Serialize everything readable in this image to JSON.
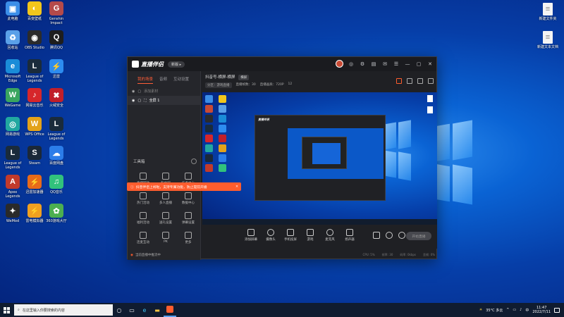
{
  "desktop": {
    "left_icons": [
      {
        "label": "此电脑",
        "glyph": "▣",
        "color": "#3b8ee8"
      },
      {
        "label": "百变壁纸",
        "glyph": "◐",
        "color": "#f2c61b"
      },
      {
        "label": "Genshin Impact",
        "glyph": "G",
        "color": "#b44a4a"
      },
      {
        "label": "回收站",
        "glyph": "♻",
        "color": "#5aa0e8"
      },
      {
        "label": "OBS Studio",
        "glyph": "◉",
        "color": "#2b2b2b"
      },
      {
        "label": "腾讯QQ",
        "glyph": "Q",
        "color": "#1e1e1e"
      },
      {
        "label": "Microsoft Edge",
        "glyph": "e",
        "color": "#1a8cd8"
      },
      {
        "label": "League of Legends",
        "glyph": "L",
        "color": "#1a2b3b"
      },
      {
        "label": "迅雷",
        "glyph": "⚡",
        "color": "#2d8cf0"
      },
      {
        "label": "WeGame",
        "glyph": "W",
        "color": "#3aa55f"
      },
      {
        "label": "网易云音乐",
        "glyph": "♪",
        "color": "#d6262b"
      },
      {
        "label": "火绒安全",
        "glyph": "✖",
        "color": "#c01f2a"
      },
      {
        "label": "网易游戏",
        "glyph": "◎",
        "color": "#21a8a0"
      },
      {
        "label": "WPS Office",
        "glyph": "W",
        "color": "#e3a21a"
      },
      {
        "label": "League of Legends",
        "glyph": "L",
        "color": "#1a2b3b"
      },
      {
        "label": "League of Legends",
        "glyph": "L",
        "color": "#1a2b3b"
      },
      {
        "label": "Steam",
        "glyph": "S",
        "color": "#1b2838"
      },
      {
        "label": "百度网盘",
        "glyph": "☁",
        "color": "#2b7de9"
      },
      {
        "label": "Apex Legends",
        "glyph": "A",
        "color": "#c23a2b"
      },
      {
        "label": "迅雷加速器",
        "glyph": "⚡",
        "color": "#e86a1a"
      },
      {
        "label": "QQ音乐",
        "glyph": "♫",
        "color": "#31c27c"
      },
      {
        "label": "WeMod",
        "glyph": "✦",
        "color": "#2a2a2a"
      },
      {
        "label": "雷电模拟器",
        "glyph": "⚡",
        "color": "#f0a020"
      },
      {
        "label": "360游戏大厅",
        "glyph": "✿",
        "color": "#4caf50"
      }
    ],
    "right_icons": [
      {
        "label": "新建文件夹"
      },
      {
        "label": "新建文本文档"
      }
    ]
  },
  "app": {
    "title": "直播伴侣",
    "version_badge": "新版 ▸",
    "left_tabs": [
      "我的场景",
      "音频",
      "互动设置"
    ],
    "scene_add_label": "添加素材",
    "scene_name": "全屏 1",
    "toolbox_label": "工具箱",
    "tools": [
      {
        "label": "直播回放"
      },
      {
        "label": "粉丝团"
      },
      {
        "label": "任务中心"
      },
      {
        "label": "热门活动"
      },
      {
        "label": "多人直播"
      },
      {
        "label": "数据中心"
      },
      {
        "label": "福利活动"
      },
      {
        "label": "送礼设置"
      },
      {
        "label": "弹幕设置"
      },
      {
        "label": "连麦互动"
      },
      {
        "label": "PK"
      },
      {
        "label": "更多"
      }
    ],
    "left_footer": "当前直播中推流中",
    "room_title": "抖音号-横屏-横屏",
    "room_tag": "横屏",
    "room_meta": [
      "分区：游戏直播",
      "直播帧数：30",
      "直播画质：720P",
      "12"
    ],
    "banner_text": "抖音伴侣上线啦，支持专属功能，防止提前开播",
    "toolbar": [
      {
        "label": "添加屏幕",
        "name": "screen"
      },
      {
        "label": "摄像头",
        "name": "camera"
      },
      {
        "label": "手机投屏",
        "name": "phone"
      },
      {
        "label": "游戏",
        "name": "game"
      },
      {
        "label": "麦克风",
        "name": "mic"
      },
      {
        "label": "扬声器",
        "name": "speaker"
      }
    ],
    "start_live_label": "开始直播",
    "status": [
      "CPU: 5%",
      "帧率: 30",
      "码率: 0kbps",
      "丢帧: 0%"
    ]
  },
  "taskbar": {
    "search_placeholder": "在这里输入你要搜索的内容",
    "weather": "35°C 多云",
    "time": "11:47",
    "date": "2022/7/11",
    "ime": "中",
    "accent": "#ff5d2e"
  }
}
